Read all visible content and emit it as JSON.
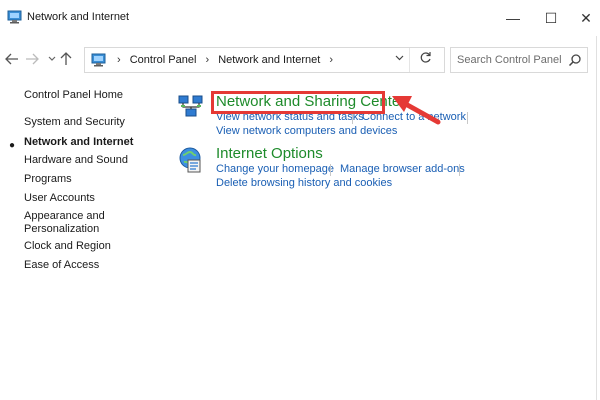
{
  "window": {
    "title": "Network and Internet",
    "min_glyph": "—",
    "max_glyph": "☐",
    "close_glyph": "✕"
  },
  "address": {
    "crumbs": [
      "Control Panel",
      "Network and Internet"
    ],
    "separator": "›"
  },
  "search": {
    "placeholder": "Search Control Panel"
  },
  "sidebar": {
    "items": [
      {
        "label": "Control Panel Home"
      },
      {
        "label": "System and Security"
      },
      {
        "label": "Network and Internet",
        "active": true
      },
      {
        "label": "Hardware and Sound"
      },
      {
        "label": "Programs"
      },
      {
        "label": "User Accounts"
      },
      {
        "label": "Appearance and Personalization",
        "line1": "Appearance and",
        "line2": "Personalization"
      },
      {
        "label": "Clock and Region"
      },
      {
        "label": "Ease of Access"
      }
    ]
  },
  "categories": {
    "network_sharing": {
      "title": "Network and Sharing Center",
      "links": [
        "View network status and tasks",
        "Connect to a network",
        "View network computers and devices"
      ]
    },
    "internet_options": {
      "title": "Internet Options",
      "links": [
        "Change your homepage",
        "Manage browser add-ons",
        "Delete browsing history and cookies"
      ]
    }
  },
  "colors": {
    "title_green": "#1e8b2b",
    "link_blue": "#1a5fb4",
    "highlight_red": "#e53935"
  }
}
